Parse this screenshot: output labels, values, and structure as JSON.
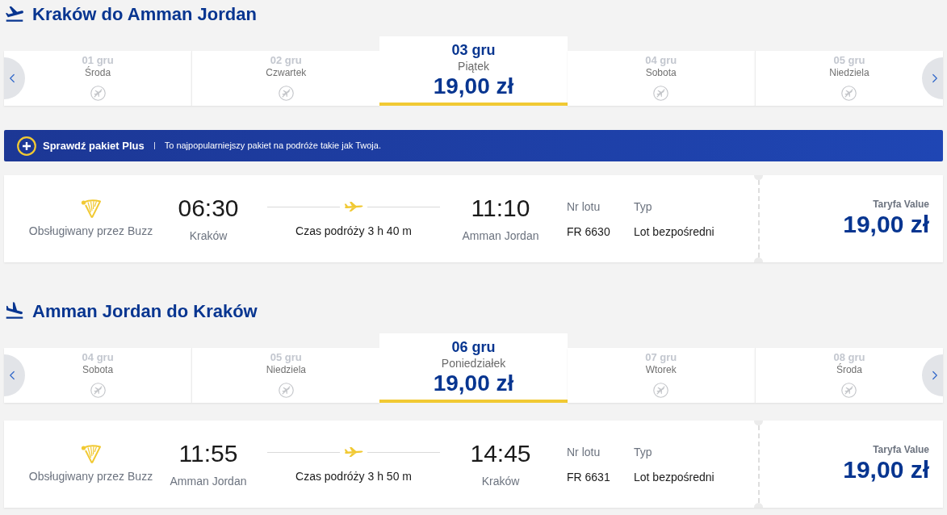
{
  "journeys": [
    {
      "kind": "outbound",
      "title": "Kraków do Amman Jordan",
      "dates": [
        {
          "date": "01 gru",
          "day": "Środa",
          "selected": false
        },
        {
          "date": "02 gru",
          "day": "Czwartek",
          "selected": false
        },
        {
          "date": "03 gru",
          "day": "Piątek",
          "price": "19,00 zł",
          "selected": true
        },
        {
          "date": "04 gru",
          "day": "Sobota",
          "selected": false
        },
        {
          "date": "05 gru",
          "day": "Niedziela",
          "selected": false
        }
      ],
      "promo_banner": {
        "title": "Sprawdź pakiet Plus",
        "text": "To najpopularniejszy pakiet na podróże takie jak Twoja."
      },
      "flight": {
        "operator": "Obsługiwany przez Buzz",
        "departure_time": "06:30",
        "departure_city": "Kraków",
        "duration": "Czas podróży 3 h 40 m",
        "arrival_time": "11:10",
        "arrival_city": "Amman Jordan",
        "flight_number_label": "Nr lotu",
        "flight_number": "FR 6630",
        "type_label": "Typ",
        "type": "Lot bezpośredni",
        "fare_label": "Taryfa Value",
        "price": "19,00 zł"
      }
    },
    {
      "kind": "return",
      "title": "Amman Jordan do Kraków",
      "dates": [
        {
          "date": "04 gru",
          "day": "Sobota",
          "selected": false
        },
        {
          "date": "05 gru",
          "day": "Niedziela",
          "selected": false
        },
        {
          "date": "06 gru",
          "day": "Poniedziałek",
          "price": "19,00 zł",
          "selected": true
        },
        {
          "date": "07 gru",
          "day": "Wtorek",
          "selected": false
        },
        {
          "date": "08 gru",
          "day": "Środa",
          "selected": false
        }
      ],
      "flight": {
        "operator": "Obsługiwany przez Buzz",
        "departure_time": "11:55",
        "departure_city": "Amman Jordan",
        "duration": "Czas podróży 3 h 50 m",
        "arrival_time": "14:45",
        "arrival_city": "Kraków",
        "flight_number_label": "Nr lotu",
        "flight_number": "FR 6631",
        "type_label": "Typ",
        "type": "Lot bezpośredni",
        "fare_label": "Taryfa Value",
        "price": "19,00 zł"
      }
    }
  ]
}
